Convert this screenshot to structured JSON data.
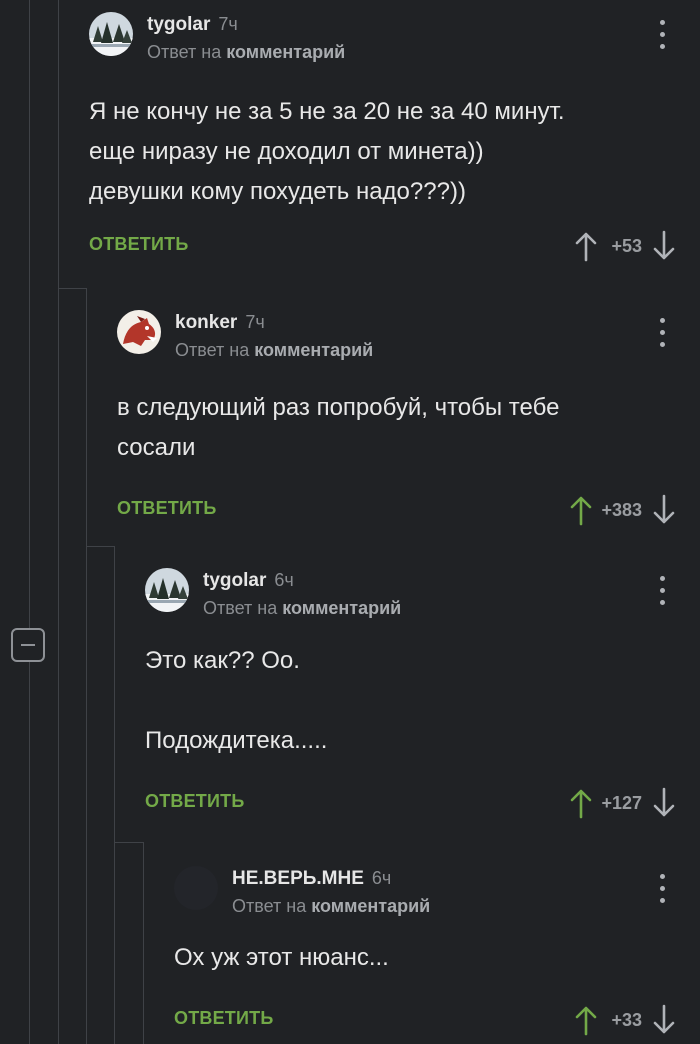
{
  "ui": {
    "reply_label": "ОТВЕТИТЬ",
    "reply_to_prefix": "Ответ на",
    "reply_to_target": "комментарий",
    "colors": {
      "background": "#202225",
      "reply_green": "#73a948",
      "upvoted_green": "#73a948",
      "neutral_arrow": "#b0b3b8"
    }
  },
  "comments": [
    {
      "username": "tygolar",
      "time": "7ч",
      "lines": [
        "Я не кончу не за 5 не за 20 не за 40 минут.",
        "еще ниразу не доходил от минета))",
        "девушки кому похудеть надо???))"
      ],
      "score": "+53",
      "upvoted": false,
      "avatar_icon": "winter-landscape-avatar"
    },
    {
      "username": "konker",
      "time": "7ч",
      "lines": [
        "в следующий раз попробуй, чтобы тебе",
        "сосали"
      ],
      "score": "+383",
      "upvoted": true,
      "avatar_icon": "red-horse-avatar"
    },
    {
      "username": "tygolar",
      "time": "6ч",
      "lines": [
        "Это как?? Оо.",
        "",
        "Подождитека....."
      ],
      "score": "+127",
      "upvoted": true,
      "avatar_icon": "winter-landscape-avatar"
    },
    {
      "username": "НЕ.ВЕРЬ.МНЕ",
      "time": "6ч",
      "lines": [
        "Ох уж этот нюанс..."
      ],
      "score": "+33",
      "upvoted": true,
      "avatar_icon": "dark-avatar"
    }
  ]
}
